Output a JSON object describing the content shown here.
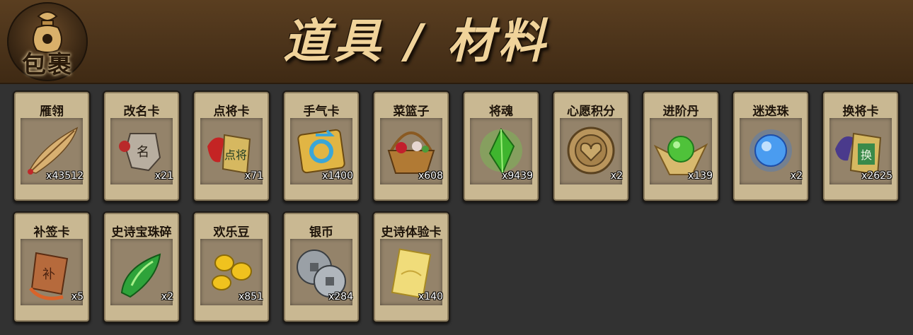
{
  "header": {
    "bag_label": "包裹",
    "title": "道具 / 材料"
  },
  "items_row1": [
    {
      "name": "雁翎",
      "count": "x43512",
      "icon": "feather-icon"
    },
    {
      "name": "改名卡",
      "count": "x21",
      "icon": "rename-tag-icon"
    },
    {
      "name": "点将卡",
      "count": "x71",
      "icon": "general-card-icon"
    },
    {
      "name": "手气卡",
      "count": "x1400",
      "icon": "luck-card-icon"
    },
    {
      "name": "菜篮子",
      "count": "x608",
      "icon": "basket-icon"
    },
    {
      "name": "将魂",
      "count": "x9439",
      "icon": "green-crystal-icon"
    },
    {
      "name": "心愿积分",
      "count": "x2",
      "icon": "heart-coin-icon"
    },
    {
      "name": "进阶丹",
      "count": "x139",
      "icon": "green-pill-icon"
    },
    {
      "name": "迷迭珠",
      "count": "x2",
      "icon": "blue-orb-icon"
    },
    {
      "name": "换将卡",
      "count": "x2625",
      "icon": "swap-card-icon"
    }
  ],
  "items_row2": [
    {
      "name": "补签卡",
      "count": "x5",
      "icon": "copper-token-icon"
    },
    {
      "name": "史诗宝珠碎",
      "count": "x2",
      "icon": "jade-shard-icon"
    },
    {
      "name": "欢乐豆",
      "count": "x851",
      "icon": "gold-beans-icon"
    },
    {
      "name": "银币",
      "count": "x284",
      "icon": "silver-coin-icon"
    },
    {
      "name": "史诗体验卡",
      "count": "x140",
      "icon": "gold-card-icon"
    }
  ]
}
